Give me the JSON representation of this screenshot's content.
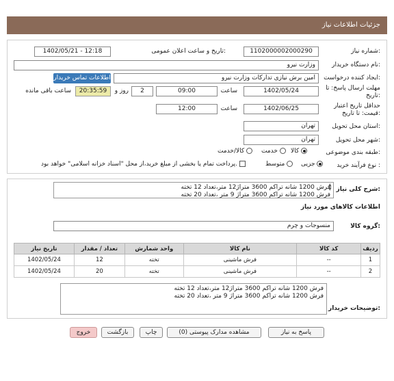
{
  "title": "جزئیات اطلاعات نیاز",
  "need_number": {
    "label": "شماره نیاز:",
    "value": "1102000002000290"
  },
  "announce": {
    "label": "تاریخ و ساعت اعلان عمومی:",
    "value": "1402/05/21 - 12:18"
  },
  "buyer_org": {
    "label": "نام دستگاه خریدار:",
    "value": "وزارت نیرو"
  },
  "creator": {
    "label": "ایجاد کننده درخواست:",
    "value": "امین برش نیازی تدارکات وزارت نیرو",
    "contact_link": "اطلاعات تماس خریدار"
  },
  "deadline": {
    "label": "مهلت ارسال پاسخ: تا تاریخ:",
    "date": "1402/05/24",
    "time_label": "ساعت",
    "time": "09:00",
    "days": "2",
    "days_label": "روز و",
    "remaining": "20:35:59",
    "remaining_label": "ساعت باقی مانده"
  },
  "validity": {
    "label": "حداقل تاریخ اعتبار قیمت: تا تاریخ:",
    "date": "1402/06/25",
    "time_label": "ساعت",
    "time": "12:00"
  },
  "province": {
    "label": "استان محل تحویل:",
    "value": "تهران"
  },
  "city": {
    "label": "شهر محل تحویل:",
    "value": "تهران"
  },
  "category": {
    "label": "طبقه بندی موضوعی:",
    "options": [
      "کالا",
      "خدمت",
      "کالا/خدمت"
    ],
    "selected": 0
  },
  "process": {
    "label": "نوع فرآیند خرید :",
    "options": [
      "جزیی",
      "متوسط"
    ],
    "selected": 0,
    "payment_note": "پرداخت تمام یا بخشی از مبلغ خرید،از محل \"اسناد خزانه اسلامی\" خواهد بود."
  },
  "summary": {
    "label": "شرح کلی نیاز:",
    "lines": "فرش 1200 شانه تراکم 3600  متراژ12 متر،تعداد 12 تخته\nفرش 1200 شانه تراکم 3600 متراژ 9 متر ،تعداد 20 تخته"
  },
  "goods_info_title": "اطلاعات کالاهای مورد نیاز",
  "goods_group": {
    "label": "گروه کالا:",
    "value": "منسوجات و چرم"
  },
  "table": {
    "headers": [
      "ردیف",
      "کد کالا",
      "نام کالا",
      "واحد شمارش",
      "تعداد / مقدار",
      "تاریخ نیاز"
    ],
    "rows": [
      [
        "1",
        "--",
        "فرش ماشینی",
        "تخته",
        "12",
        "1402/05/24"
      ],
      [
        "2",
        "--",
        "فرش ماشینی",
        "تخته",
        "20",
        "1402/05/24"
      ]
    ]
  },
  "buyer_notes": {
    "label": "توضیحات خریدار:",
    "lines": "فرش 1200 شانه تراکم 3600  متراژ12 متر،تعداد 12 تخته\nفرش 1200 شانه تراکم 3600 متراژ 9 متر ،تعداد 20 تخته"
  },
  "buttons": {
    "reply": "پاسخ به نیاز",
    "docs": "مشاهده مدارک پیوستی (0)",
    "print": "چاپ",
    "back": "بازگشت",
    "exit": "خروج"
  }
}
